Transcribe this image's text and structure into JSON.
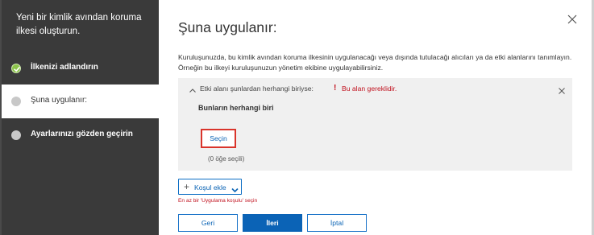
{
  "wizard": {
    "title": "Yeni bir kimlik avından koruma ilkesi oluşturun.",
    "steps": [
      {
        "label": "İlkenizi adlandırın",
        "status": "completed"
      },
      {
        "label": "Şuna uygulanır:",
        "status": "current"
      },
      {
        "label": "Ayarlarınızı gözden geçirin",
        "status": "pending"
      }
    ]
  },
  "main": {
    "title": "Şuna uygulanır:",
    "description": "Kuruluşunuzda, bu kimlik avından koruma ilkesinin uygulanacağı veya dışında tutulacağı alıcıları ya da etki alanlarını tanımlayın. Örneğin bu ilkeyi kuruluşunuzun yönetim ekibine uygulayabilirsiniz.",
    "condition": {
      "label": "Etki alanı şunlardan herhangi biriyse:",
      "error_icon": "!",
      "error": "Bu alan gereklidir.",
      "any_of": "Bunların herhangi biri",
      "select_label": "Seçin",
      "selected_count": "(0 öğe seçili)"
    },
    "add_condition": {
      "label": "Koşul ekle",
      "hint": "En az bir 'Uygulama koşulu' seçin"
    },
    "buttons": {
      "back": "Geri",
      "next": "İleri",
      "cancel": "İptal"
    }
  },
  "colors": {
    "sidebar_bg": "#3a3a3a",
    "accent": "#0b63b6",
    "error": "#c1121f",
    "check": "#8bc34a",
    "panel_bg": "#f0f0f0"
  },
  "icons": [
    "check-circle-icon",
    "step-dot-icon",
    "close-icon",
    "chevron-up-icon",
    "plus-icon",
    "chevron-down-icon"
  ]
}
